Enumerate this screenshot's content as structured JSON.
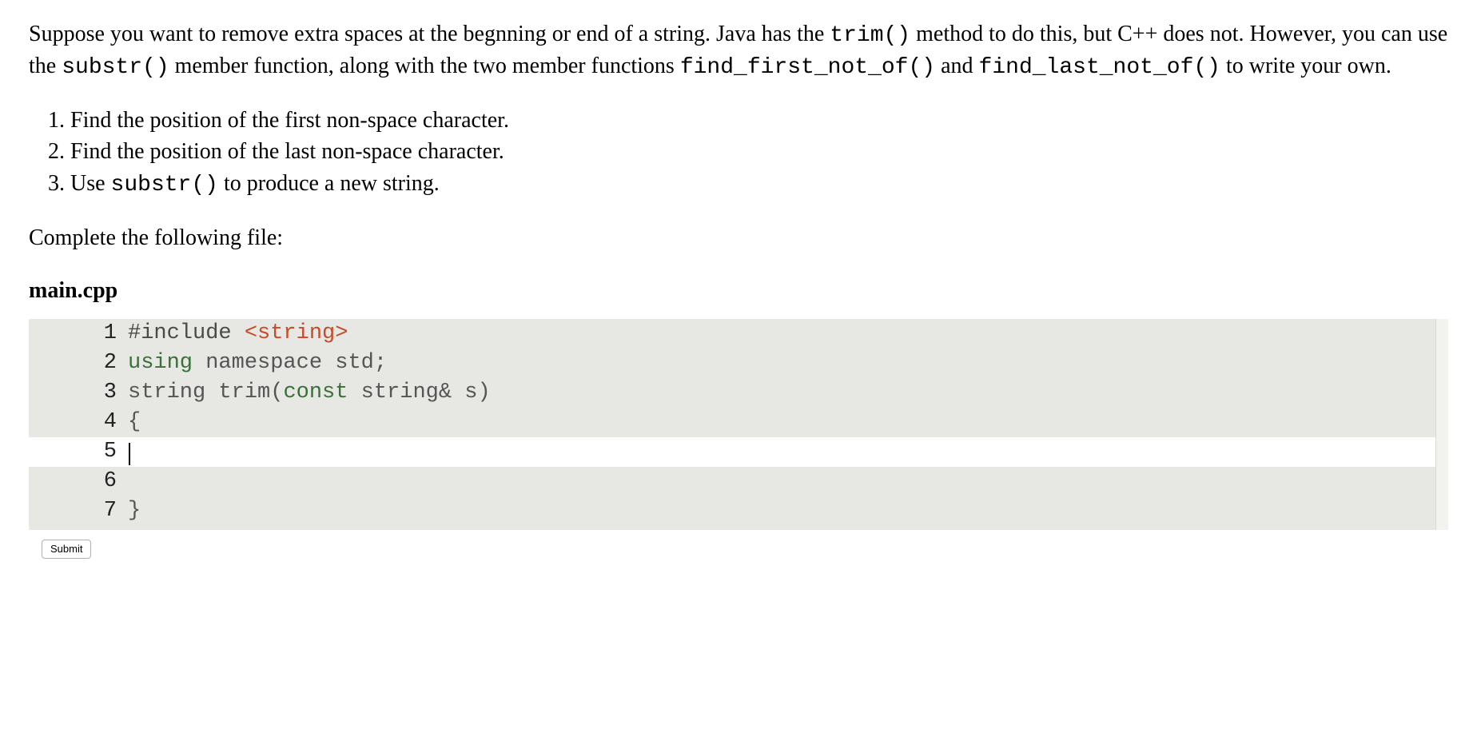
{
  "intro": {
    "part1": "Suppose you want to remove extra spaces at the begnning or end of a string. Java has the ",
    "code1": "trim()",
    "part2": " method to do this, but C++ does not. However, you can use the ",
    "code2": "substr()",
    "part3": " member function, along with the two member functions ",
    "code3": "find_first_not_of()",
    "part4": " and ",
    "code4": "find_last_not_of()",
    "part5": " to write your own."
  },
  "steps": {
    "s1": "Find the position of the first non-space character.",
    "s2": "Find the position of the last non-space character.",
    "s3a": "Use ",
    "s3code": "substr()",
    "s3b": " to produce a new string."
  },
  "complete_text": "Complete the following file:",
  "filename": "main.cpp",
  "code": {
    "lines": {
      "n1": "1",
      "n2": "2",
      "n3": "3",
      "n4": "4",
      "n5": "5",
      "n6": "6",
      "n7": "7"
    },
    "l1_include": "#include ",
    "l1_header": "<string>",
    "l2_a": "using",
    "l2_b": " namespace std;",
    "l3_a": "string trim(",
    "l3_b": "const",
    "l3_c": " string& s)",
    "l4": "{",
    "l5": "",
    "l6": " ",
    "l7": "}"
  },
  "submit_label": "Submit"
}
